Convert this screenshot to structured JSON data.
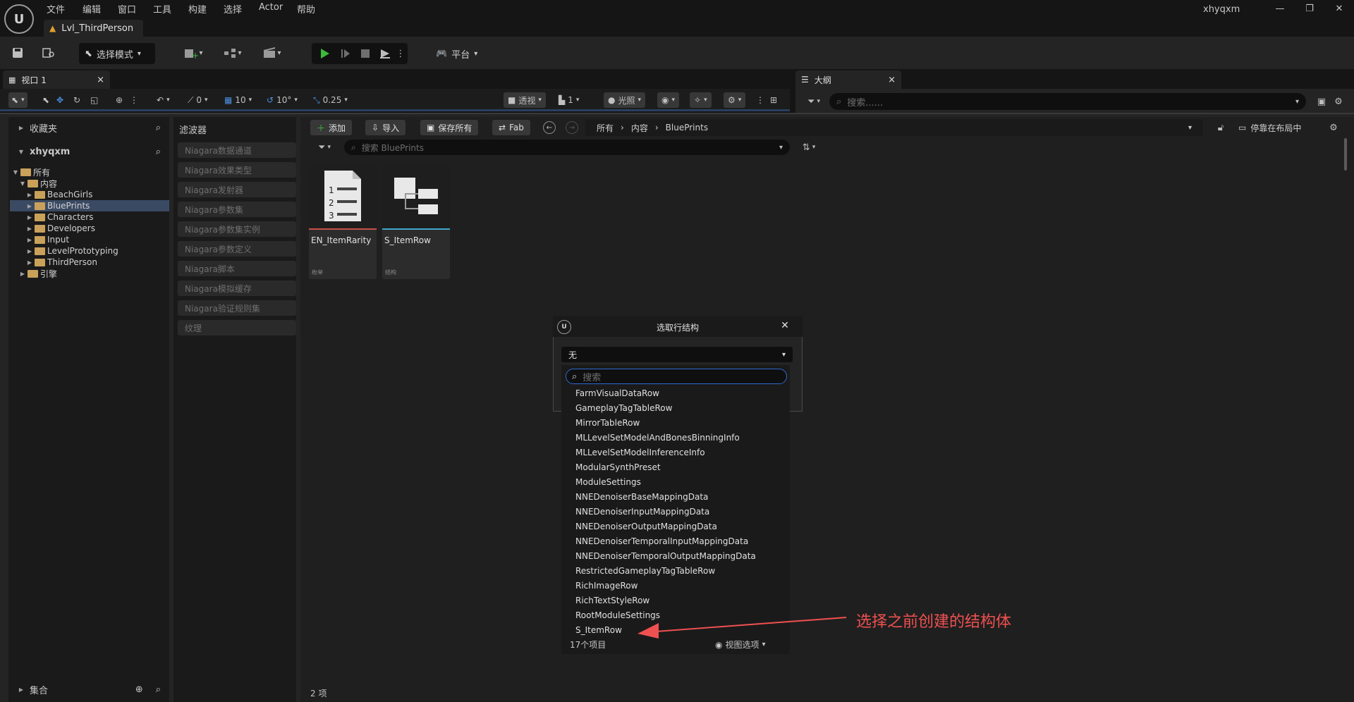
{
  "menubar": {
    "items": [
      "文件",
      "编辑",
      "窗口",
      "工具",
      "构建",
      "选择",
      "Actor",
      "帮助"
    ],
    "level_tab": "Lvl_ThirdPerson",
    "user": "xhyqxm",
    "window_controls": [
      "—",
      "❐",
      "✕"
    ]
  },
  "toolbar": {
    "mode_label": "选择模式",
    "platform_label": "平台"
  },
  "viewport": {
    "tab_label": "视口 1",
    "close": "×",
    "items": {
      "angle": "0",
      "grid": "10",
      "rotate": "10°",
      "scale": "0.25",
      "perspective": "透视",
      "camera_speed": "1",
      "lit": "光照"
    }
  },
  "outline": {
    "tab_label": "大纲",
    "close": "×",
    "search_placeholder": "搜索......"
  },
  "drawer": {
    "favorites": "收藏夹",
    "project": "xhyqxm",
    "tree": [
      {
        "label": "所有",
        "depth": 0,
        "expanded": true,
        "selected": false
      },
      {
        "label": "内容",
        "depth": 1,
        "expanded": true,
        "selected": false
      },
      {
        "label": "BeachGirls",
        "depth": 2,
        "expanded": false,
        "selected": false
      },
      {
        "label": "BluePrints",
        "depth": 2,
        "expanded": false,
        "selected": true
      },
      {
        "label": "Characters",
        "depth": 2,
        "expanded": false,
        "selected": false
      },
      {
        "label": "Developers",
        "depth": 2,
        "expanded": false,
        "selected": false
      },
      {
        "label": "Input",
        "depth": 2,
        "expanded": false,
        "selected": false
      },
      {
        "label": "LevelPrototyping",
        "depth": 2,
        "expanded": false,
        "selected": false
      },
      {
        "label": "ThirdPerson",
        "depth": 2,
        "expanded": false,
        "selected": false
      },
      {
        "label": "引擎",
        "depth": 1,
        "expanded": false,
        "selected": false
      }
    ],
    "collections": "集合",
    "filters_title": "滤波器",
    "filters": [
      "Niagara数据通道",
      "Niagara效果类型",
      "Niagara发射器",
      "Niagara参数集",
      "Niagara参数集实例",
      "Niagara参数定义",
      "Niagara脚本",
      "Niagara模拟缓存",
      "Niagara验证规则集",
      "纹理"
    ],
    "actions": {
      "add": "添加",
      "import": "导入",
      "save_all": "保存所有",
      "fab": "Fab"
    },
    "path": [
      "所有",
      "内容",
      "BluePrints"
    ],
    "dock_label": "停靠在布局中",
    "search_placeholder": "搜索 BluePrints",
    "assets": [
      {
        "name": "EN_ItemRarity",
        "type": "枚举",
        "accent": "#c8504a"
      },
      {
        "name": "S_ItemRow",
        "type": "结构",
        "accent": "#3fa8c8"
      }
    ],
    "item_count": "2 项"
  },
  "dialog": {
    "title": "选取行结构",
    "combo_value": "无",
    "search_placeholder": "搜索",
    "options": [
      "FarmVisualDataRow",
      "GameplayTagTableRow",
      "MirrorTableRow",
      "MLLevelSetModelAndBonesBinningInfo",
      "MLLevelSetModelInferenceInfo",
      "ModularSynthPreset",
      "ModuleSettings",
      "NNEDenoiserBaseMappingData",
      "NNEDenoiserInputMappingData",
      "NNEDenoiserOutputMappingData",
      "NNEDenoiserTemporalInputMappingData",
      "NNEDenoiserTemporalOutputMappingData",
      "RestrictedGameplayTagTableRow",
      "RichImageRow",
      "RichTextStyleRow",
      "RootModuleSettings",
      "S_ItemRow"
    ],
    "count_label": "17个项目",
    "view_options": "视图选项"
  },
  "annotation": {
    "text": "选择之前创建的结构体",
    "color": "#f05050"
  },
  "colors": {
    "accent_blue": "#2e6bd1",
    "play_green": "#3cba3c",
    "folder": "#c9a15a"
  }
}
